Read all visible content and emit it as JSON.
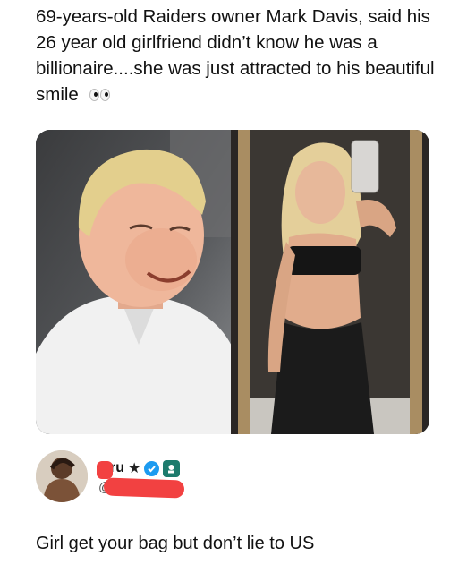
{
  "post": {
    "text": "69-years-old Raiders owner Mark Davis, said his 26 year old girlfriend didn’t know he was a billionaire....she was just attracted to his beautiful smile",
    "emoji": "eyes-icon"
  },
  "media": {
    "left_photo": "photo-man-smiling",
    "right_photo": "photo-woman-mirror-selfie"
  },
  "author": {
    "name": "F ru",
    "star": "★",
    "handle": "@"
  },
  "reply": {
    "text": "Girl get your bag but don’t lie to US"
  },
  "colors": {
    "redaction": "#f24141",
    "verified": "#1d9bf0",
    "badge": "#1d7b6d"
  }
}
